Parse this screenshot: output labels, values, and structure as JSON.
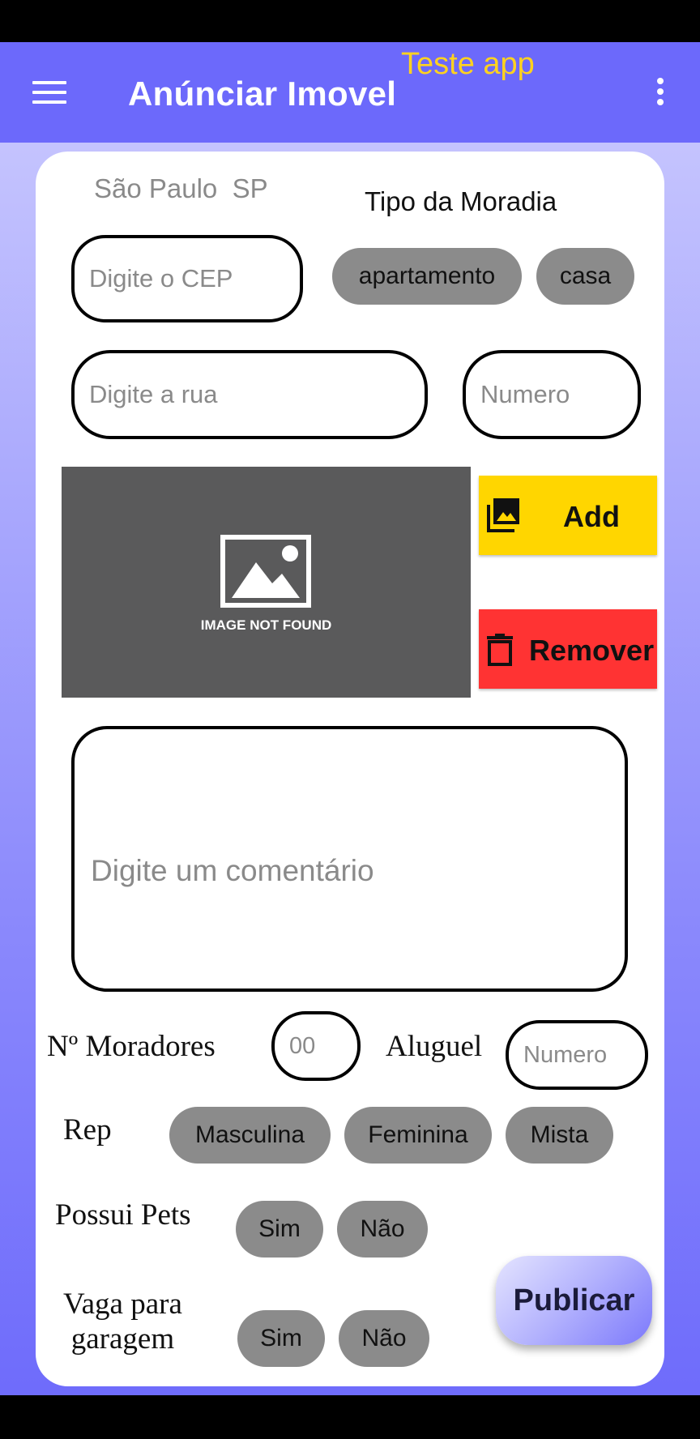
{
  "app_bar": {
    "title": "Anúnciar Imovel",
    "subtitle": "Teste app",
    "menu_icon": "hamburger-menu-icon",
    "more_icon": "more-vert-icon",
    "background": "#6c69fb",
    "subtitle_color": "#ffd21f"
  },
  "location": {
    "city": "São Paulo",
    "state": "SP"
  },
  "housing_type": {
    "label": "Tipo da Moradia",
    "options": [
      "apartamento",
      "casa"
    ]
  },
  "address": {
    "cep_placeholder": "Digite o CEP",
    "street_placeholder": "Digite a rua",
    "number_placeholder": "Numero"
  },
  "image": {
    "placeholder_caption": "IMAGE NOT FOUND",
    "add_label": "Add",
    "add_icon": "photo-library-icon",
    "add_color": "#ffd600",
    "remove_label": "Remover",
    "remove_icon": "trash-icon",
    "remove_color": "#ff3333"
  },
  "comment": {
    "placeholder": "Digite um comentário"
  },
  "residents": {
    "label": "Nº Moradores",
    "placeholder": "00"
  },
  "rent": {
    "label": "Aluguel",
    "placeholder": "Numero"
  },
  "rep": {
    "label": "Rep",
    "options": [
      "Masculina",
      "Feminina",
      "Mista"
    ]
  },
  "pets": {
    "label": "Possui Pets",
    "options": [
      "Sim",
      "Não"
    ]
  },
  "garage": {
    "label_line1": "Vaga para",
    "label_line2": "garagem",
    "options": [
      "Sim",
      "Não"
    ]
  },
  "publish": {
    "label": "Publicar"
  }
}
